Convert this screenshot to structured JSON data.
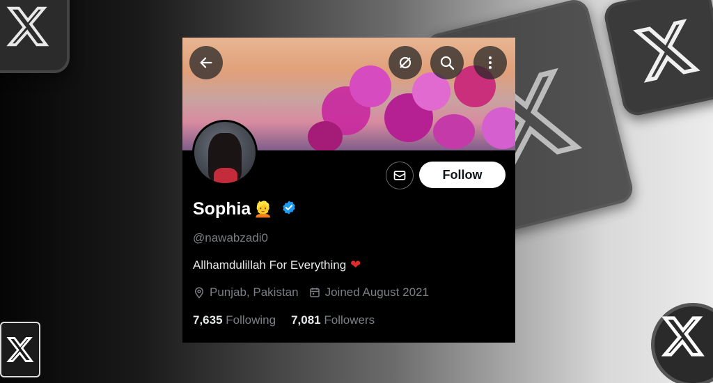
{
  "profile": {
    "name": "Sophia",
    "name_emoji": "👱",
    "verified": true,
    "handle": "@nawabzadi0",
    "bio": "Allhamdulillah For Everything",
    "bio_emoji": "❤",
    "location": "Punjab, Pakistan",
    "joined": "Joined August 2021",
    "following_count": "7,635",
    "following_label": "Following",
    "followers_count": "7,081",
    "followers_label": "Followers"
  },
  "actions": {
    "follow_label": "Follow"
  },
  "icons": {
    "back": "arrow-left-icon",
    "refresh": "refresh-icon",
    "search": "search-icon",
    "more": "more-vertical-icon",
    "message": "envelope-icon",
    "verified": "verified-badge-icon",
    "location": "location-pin-icon",
    "calendar": "calendar-icon"
  },
  "colors": {
    "verified_blue": "#1d9bf0",
    "card_bg": "#000000",
    "muted_text": "#7b7f84"
  }
}
